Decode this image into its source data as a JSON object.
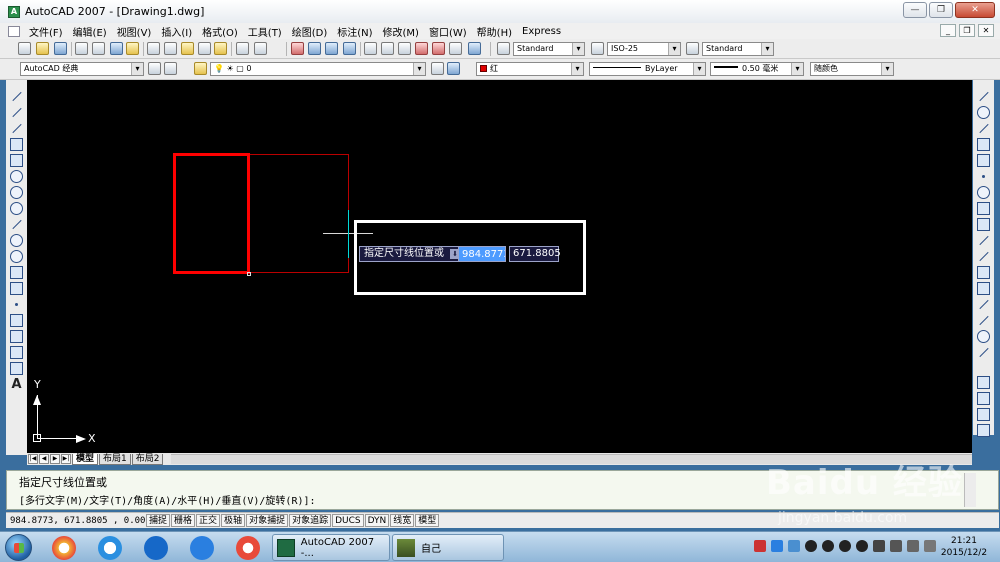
{
  "window": {
    "title": "AutoCAD 2007 - [Drawing1.dwg]",
    "buttons": {
      "minimize": "—",
      "restore": "❐",
      "close": "✕"
    }
  },
  "menu": {
    "items": [
      "文件(F)",
      "编辑(E)",
      "视图(V)",
      "插入(I)",
      "格式(O)",
      "工具(T)",
      "绘图(D)",
      "标注(N)",
      "修改(M)",
      "窗口(W)",
      "帮助(H)",
      "Express"
    ],
    "doc_buttons": {
      "minimize": "_",
      "restore": "❐",
      "close": "✕"
    }
  },
  "toolbar1": {
    "text_style": "Standard",
    "dim_style": "ISO-25",
    "table_style": "Standard"
  },
  "toolbar2": {
    "workspace": "AutoCAD 经典",
    "layer": "0",
    "color": "红",
    "linetype": "ByLayer",
    "lineweight": "0.50 毫米",
    "plotstyle": "随颜色"
  },
  "left_toolbar": {
    "text_tool": "A"
  },
  "dynamic_input": {
    "prompt": "指定尺寸线位置或",
    "down_arrow": "⬇",
    "x_value": "984.8773",
    "y_value": "671.8805"
  },
  "ucs": {
    "x_label": "X",
    "y_label": "Y"
  },
  "layout_tabs": {
    "nav": [
      "|◀",
      "◀",
      "▶",
      "▶|"
    ],
    "tabs": [
      "模型",
      "布局1",
      "布局2"
    ],
    "active": "模型"
  },
  "command_line": {
    "line1": "指定尺寸线位置或",
    "line2": "[多行文字(M)/文字(T)/角度(A)/水平(H)/垂直(V)/旋转(R)]:"
  },
  "status_bar": {
    "coords": "984.8773,  671.8805 , 0.0000",
    "buttons": [
      "捕捉",
      "栅格",
      "正交",
      "极轴",
      "对象捕捉",
      "对象追踪",
      "DUCS",
      "DYN",
      "线宽",
      "模型"
    ]
  },
  "watermark": {
    "logo": "Baidu 经验",
    "url": "jingyan.baidu.com"
  },
  "taskbar": {
    "items": [
      {
        "label": "AutoCAD 2007 -..."
      },
      {
        "label": "自己"
      }
    ],
    "clock_time": "21:21",
    "clock_date": "2015/12/2"
  },
  "colors": {
    "canvas": "#000000",
    "entity_red": "#ff0000",
    "dyn_x_highlight": "#4d9bff",
    "highlight_frame": "#ffffff"
  }
}
